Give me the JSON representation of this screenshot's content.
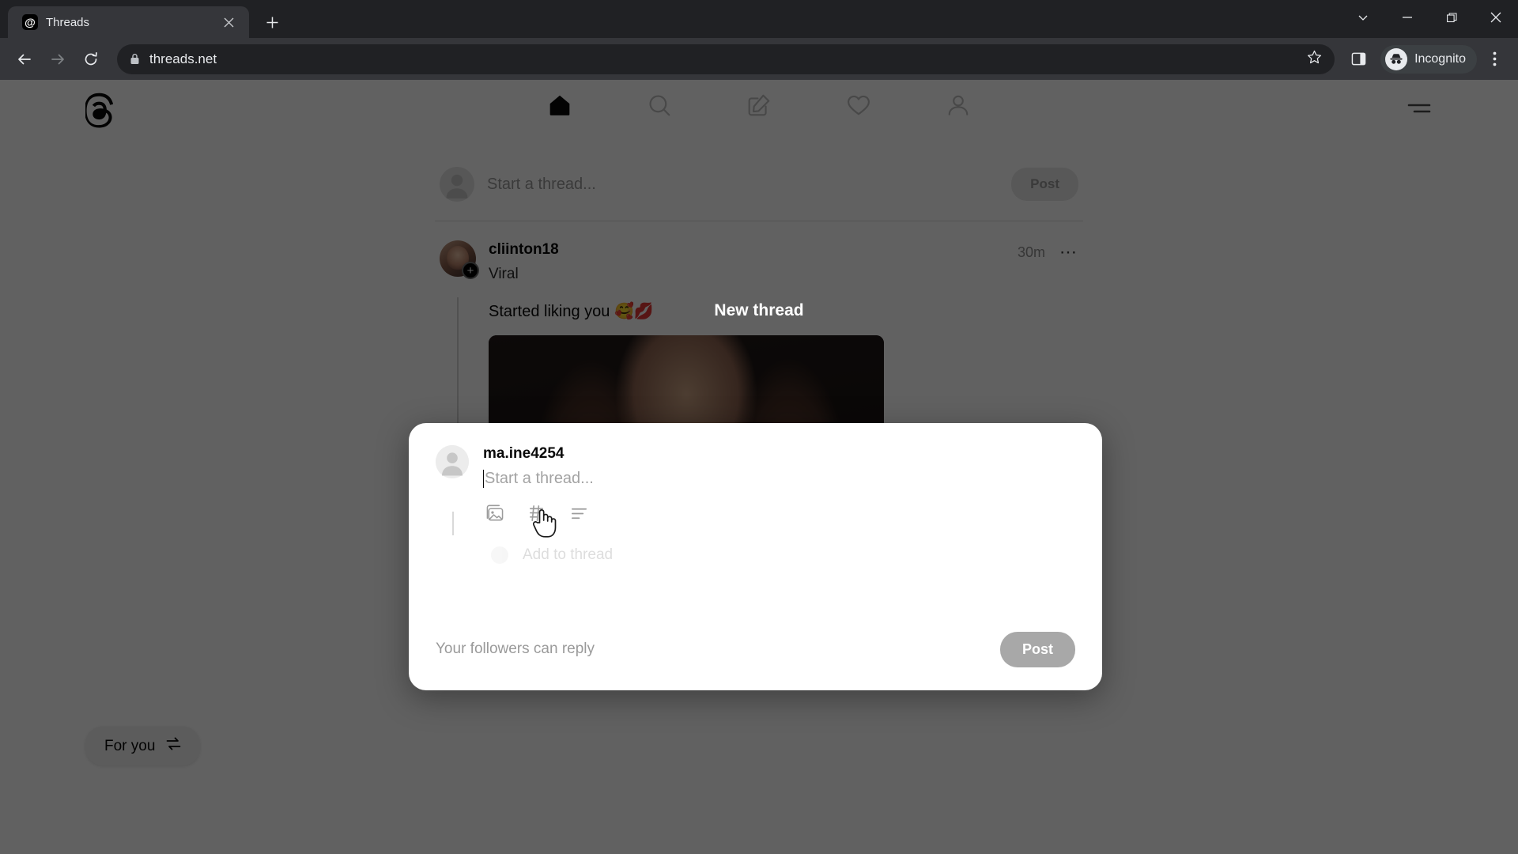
{
  "browser": {
    "tab": {
      "title": "Threads",
      "favicon": "threads-logo-icon",
      "close_icon": "close-icon"
    },
    "new_tab_icon": "plus-icon",
    "window_controls": [
      {
        "name": "tab-search-button",
        "icon": "chevron-down-icon"
      },
      {
        "name": "minimize-button",
        "icon": "minimize-icon"
      },
      {
        "name": "maximize-button",
        "icon": "restore-icon"
      },
      {
        "name": "close-window-button",
        "icon": "close-icon"
      }
    ],
    "toolbar": {
      "back_icon": "back-arrow-icon",
      "forward_icon": "forward-arrow-icon",
      "reload_icon": "reload-icon",
      "lock_icon": "lock-icon",
      "url": "threads.net",
      "star_icon": "bookmark-star-icon",
      "sidepanel_icon": "side-panel-icon",
      "incognito_label": "Incognito",
      "incognito_icon": "incognito-hat-glasses-icon",
      "menu_icon": "three-dot-menu-icon"
    }
  },
  "threads": {
    "logo_icon": "threads-at-logo-icon",
    "nav": [
      {
        "name": "nav-home",
        "icon": "home-icon",
        "active": true
      },
      {
        "name": "nav-search",
        "icon": "search-icon",
        "active": false
      },
      {
        "name": "nav-compose",
        "icon": "compose-pencil-icon",
        "active": false
      },
      {
        "name": "nav-activity",
        "icon": "heart-icon",
        "active": false
      },
      {
        "name": "nav-profile",
        "icon": "person-icon",
        "active": false
      }
    ],
    "menu_icon": "hamburger-menu-icon",
    "composer": {
      "placeholder": "Start a thread...",
      "post_label": "Post",
      "avatar_icon": "user-avatar-icon"
    },
    "post": {
      "username": "cliinton18",
      "tag": "Viral",
      "timestamp": "30m",
      "more_icon": "more-options-icon",
      "badge_icon": "plus-badge-icon",
      "text": "Started liking you 🥰💋"
    },
    "for_you": {
      "label": "For you",
      "icon": "swap-arrows-icon"
    }
  },
  "modal": {
    "title": "New thread",
    "username": "ma.ine4254",
    "placeholder": "Start a thread...",
    "avatar_icon": "user-avatar-icon",
    "tools": [
      {
        "name": "attach-image-button",
        "icon": "image-icon"
      },
      {
        "name": "attach-gif-button",
        "icon": "gif-icon"
      },
      {
        "name": "add-poll-button",
        "icon": "poll-list-icon"
      }
    ],
    "add_to_thread_label": "Add to thread",
    "reply_setting": "Your followers can reply",
    "post_label": "Post"
  },
  "cursor": {
    "icon": "pointing-hand-cursor"
  },
  "colors": {
    "chrome_bg": "#202124",
    "toolbar_bg": "#35363a",
    "page_bg": "#ffffff",
    "scrim": "rgba(0,0,0,0.62)",
    "post_disabled": "#a8a8a8",
    "text_muted": "#9a9a9a"
  }
}
